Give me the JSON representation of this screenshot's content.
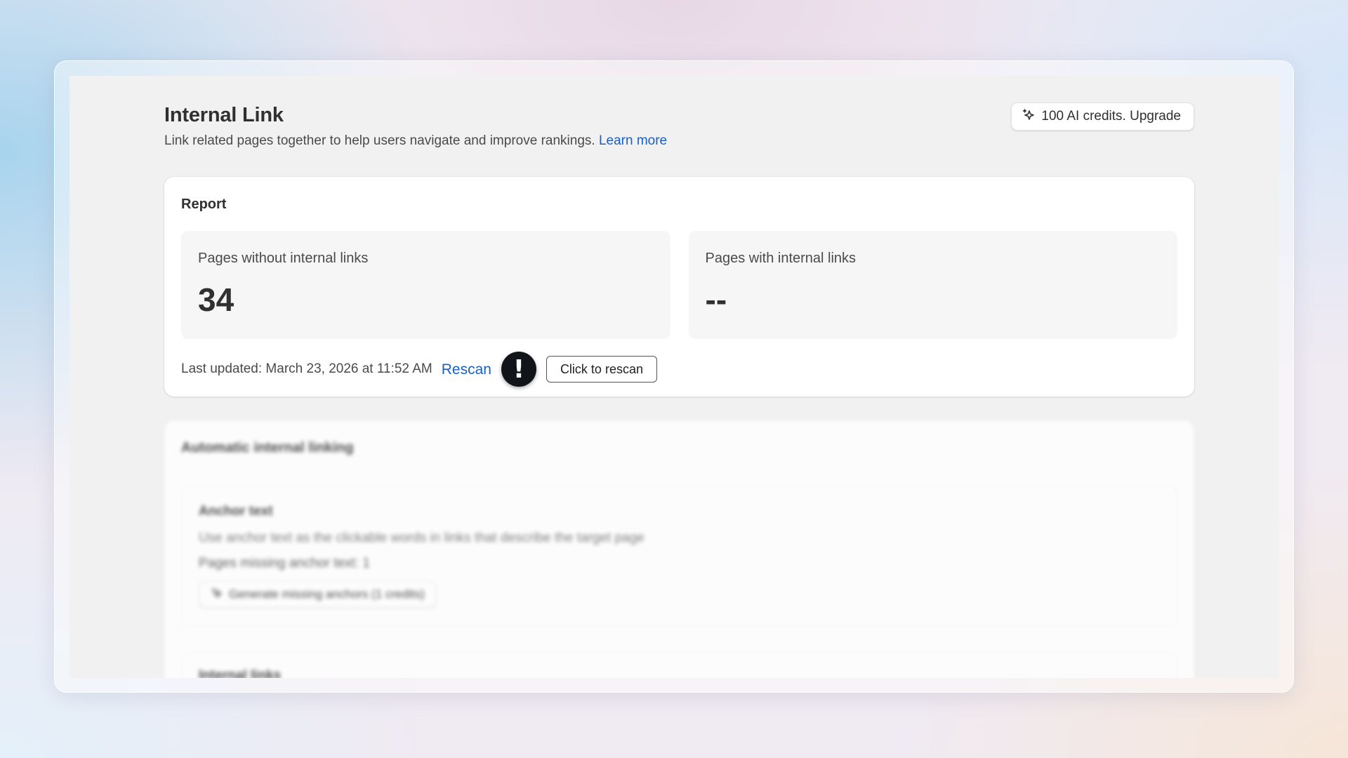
{
  "header": {
    "title": "Internal Link",
    "subtitle": "Link related pages together to help users navigate and improve rankings.",
    "learn_more": "Learn more",
    "credits_button": "100 AI credits. Upgrade"
  },
  "report": {
    "title": "Report",
    "stats": [
      {
        "label": "Pages without internal links",
        "value": "34"
      },
      {
        "label": "Pages with internal links",
        "value": "--"
      }
    ],
    "last_updated": "Last updated: March 23, 2026 at 11:52 AM",
    "rescan_link": "Rescan",
    "alert_glyph": "!",
    "rescan_tooltip": "Click to rescan"
  },
  "automatic": {
    "title": "Automatic internal linking",
    "anchor": {
      "title": "Anchor text",
      "description": "Use anchor text as the clickable words in links that describe the target page",
      "missing": "Pages missing anchor text: 1",
      "generate_button": "Generate missing anchors (1 credits)"
    },
    "internal_links": {
      "title": "Internal links"
    }
  },
  "icons": {
    "credits": "sparkle-icon",
    "generate": "sparkle-icon",
    "alert": "exclamation-icon"
  },
  "colors": {
    "link": "#1a5fc4",
    "surface": "#f1f1f1",
    "card": "#ffffff",
    "alert_badge": "#111418"
  }
}
